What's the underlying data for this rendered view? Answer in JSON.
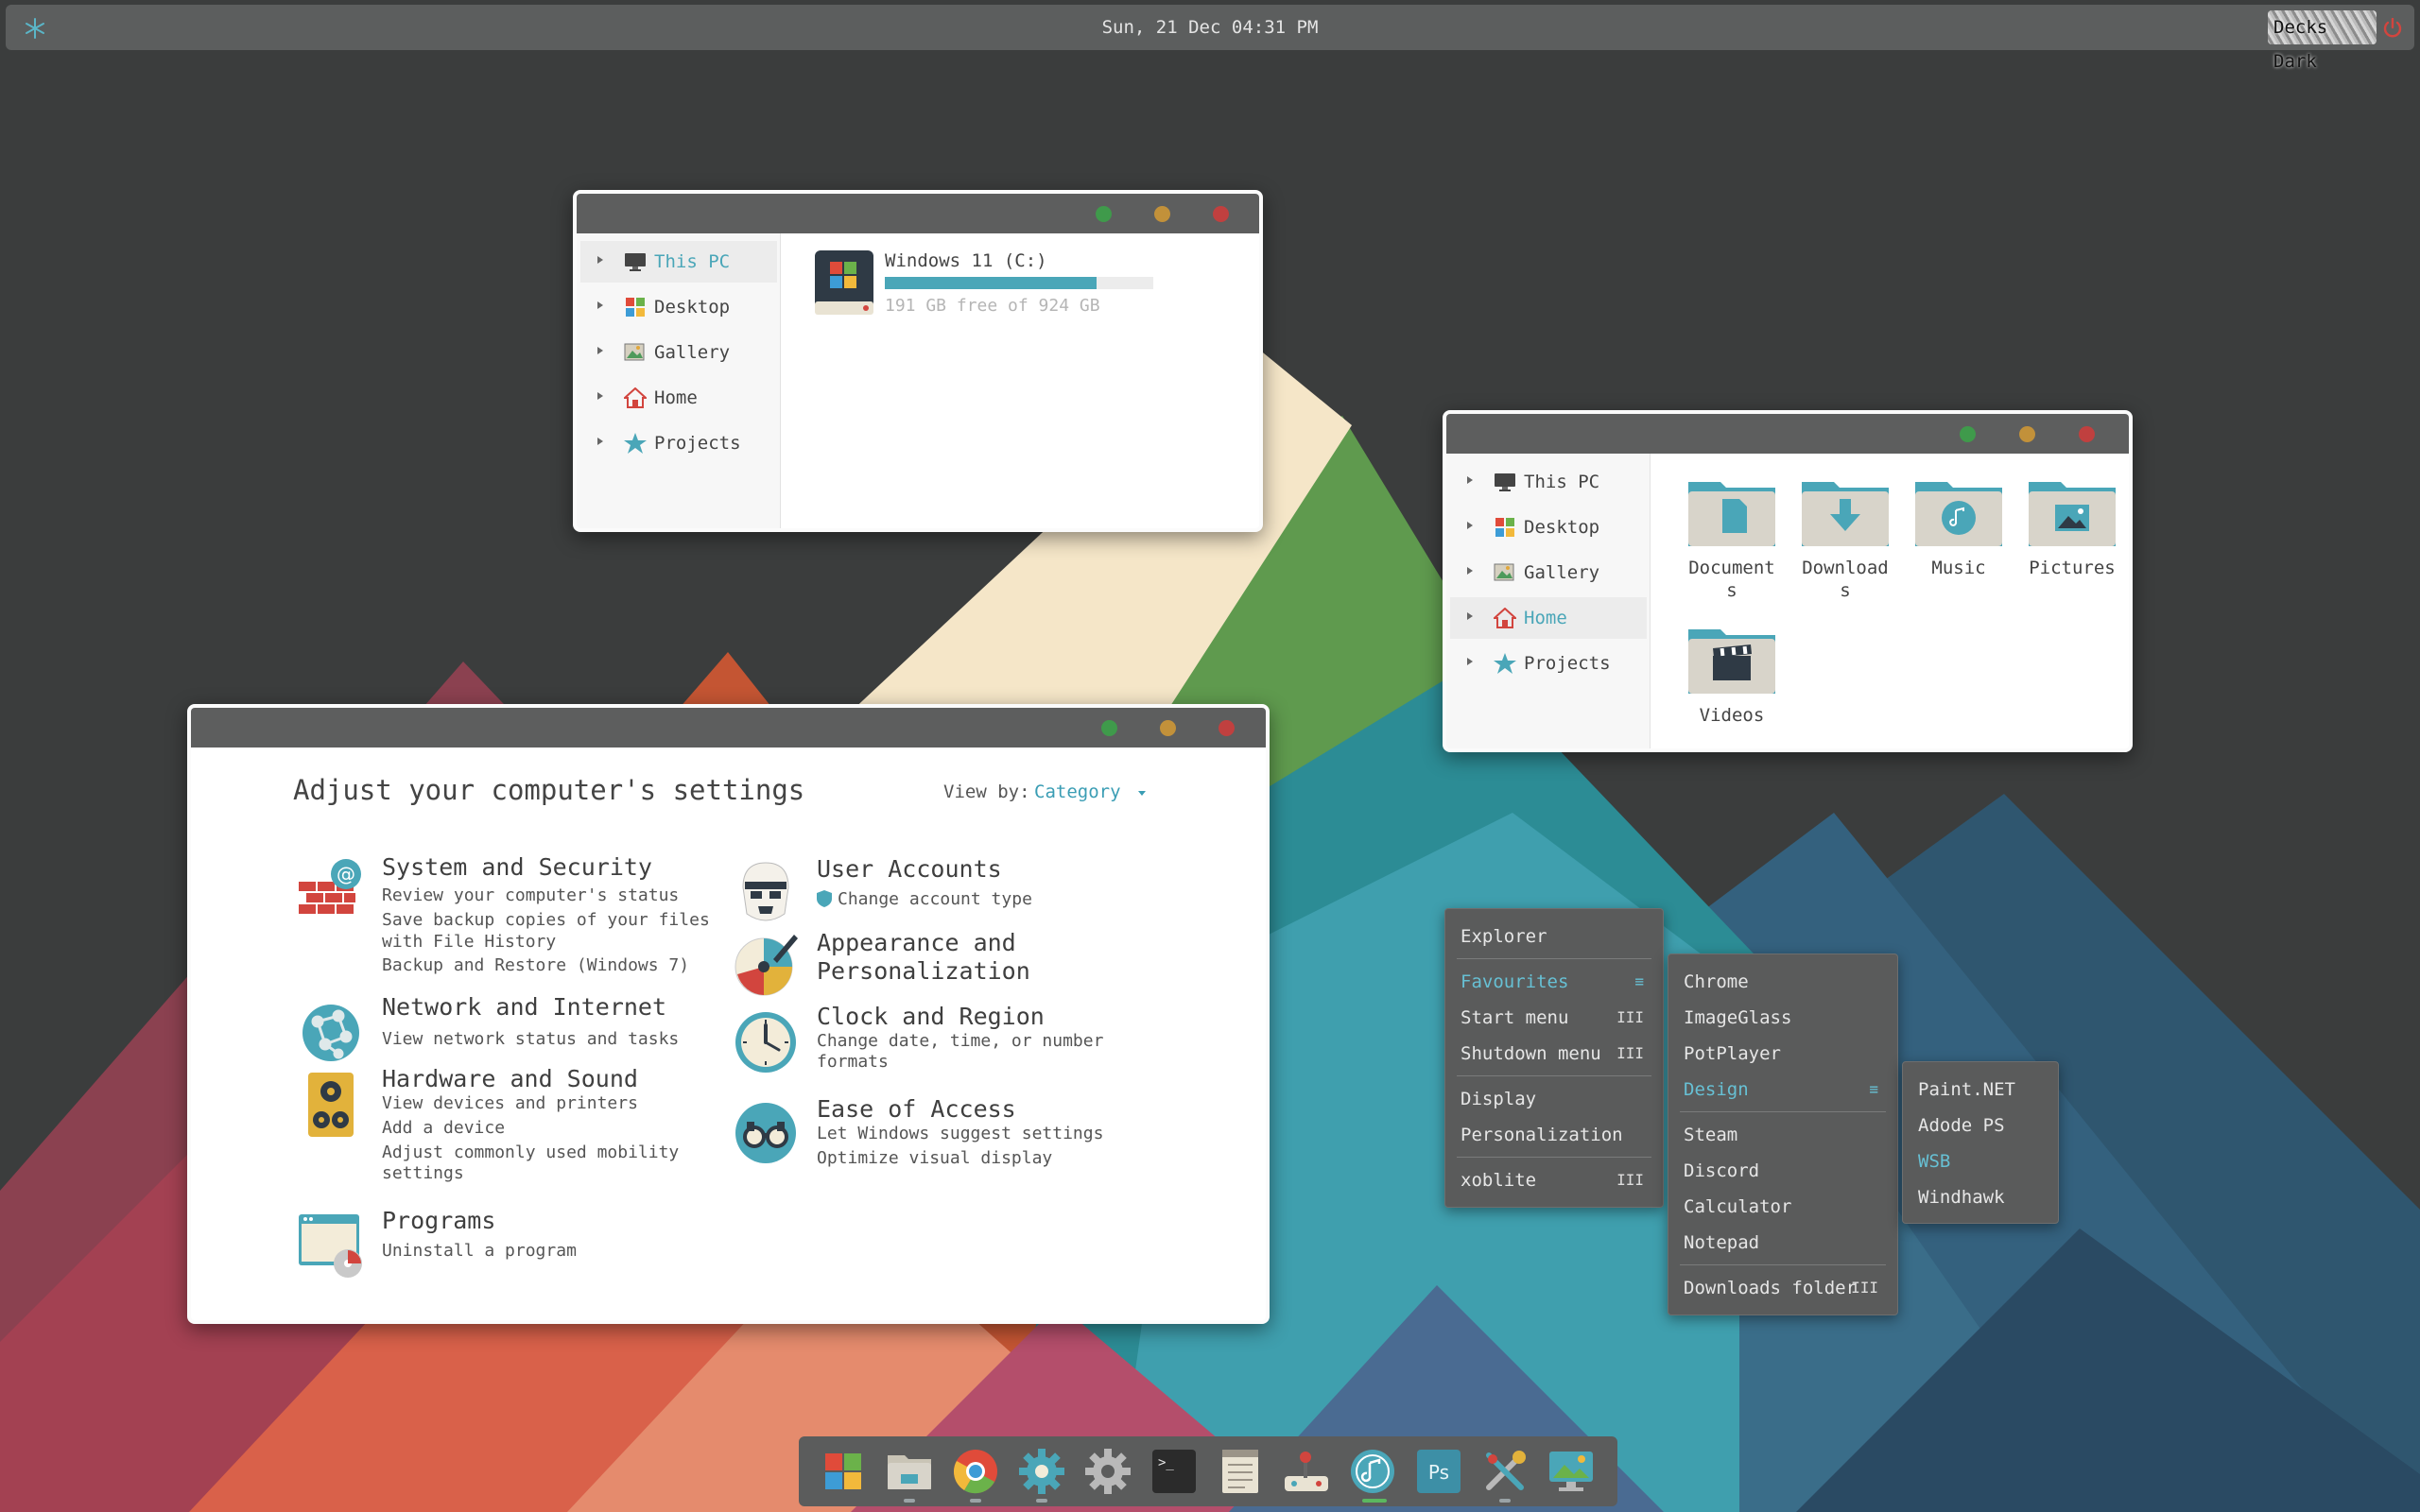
{
  "topbar": {
    "clock": "Sun, 21 Dec 04:31 PM",
    "theme_label": "Decks Dark",
    "left_icon": "snowflake-icon",
    "right_icon": "power-icon"
  },
  "explorer_pc": {
    "sidebar": [
      {
        "label": "This PC",
        "icon": "monitor-icon",
        "active": true
      },
      {
        "label": "Desktop",
        "icon": "windows-logo-icon",
        "active": false
      },
      {
        "label": "Gallery",
        "icon": "gallery-icon",
        "active": false
      },
      {
        "label": "Home",
        "icon": "home-icon",
        "active": false
      },
      {
        "label": "Projects",
        "icon": "star-icon",
        "active": false
      }
    ],
    "drive": {
      "name": "Windows 11 (C:)",
      "free_text": "191 GB free of 924 GB",
      "used_fraction": 0.79
    }
  },
  "explorer_home": {
    "sidebar": [
      {
        "label": "This PC",
        "icon": "monitor-icon",
        "active": false
      },
      {
        "label": "Desktop",
        "icon": "windows-logo-icon",
        "active": false
      },
      {
        "label": "Gallery",
        "icon": "gallery-icon",
        "active": false
      },
      {
        "label": "Home",
        "icon": "home-icon",
        "active": true
      },
      {
        "label": "Projects",
        "icon": "star-icon",
        "active": false
      }
    ],
    "folders": [
      {
        "line1": "Document",
        "line2": "s",
        "icon": "documents-folder-icon"
      },
      {
        "line1": "Download",
        "line2": "s",
        "icon": "downloads-folder-icon"
      },
      {
        "line1": "Music",
        "line2": "",
        "icon": "music-folder-icon"
      },
      {
        "line1": "Pictures",
        "line2": "",
        "icon": "pictures-folder-icon"
      },
      {
        "line1": "Videos",
        "line2": "",
        "icon": "videos-folder-icon"
      }
    ]
  },
  "control_panel": {
    "title": "Adjust your computer's settings",
    "view_by_label": "View by:",
    "view_by_value": "Category",
    "categories": [
      {
        "title": "System and Security",
        "icon": "firewall-icon",
        "links": [
          "Review your computer's status",
          "Save backup copies of your files",
          "with File History",
          "Backup and Restore (Windows 7)"
        ]
      },
      {
        "title": "Network and Internet",
        "icon": "network-globe-icon",
        "links": [
          "View network status and tasks"
        ]
      },
      {
        "title": "Hardware and Sound",
        "icon": "speaker-icon",
        "links": [
          "View devices and printers",
          "Add a device",
          "Adjust commonly used mobility",
          "settings"
        ]
      },
      {
        "title": "Programs",
        "icon": "programs-icon",
        "links": [
          "Uninstall a program"
        ]
      },
      {
        "title": "User Accounts",
        "icon": "user-accounts-icon",
        "links": [
          "Change account type"
        ]
      },
      {
        "title": "Appearance and",
        "title2": "Personalization",
        "icon": "palette-icon",
        "links": []
      },
      {
        "title": "Clock and Region",
        "icon": "clock-icon",
        "links": [
          "Change date, time, or number",
          "formats"
        ]
      },
      {
        "title": "Ease of Access",
        "icon": "ease-of-access-icon",
        "links": [
          "Let Windows suggest settings",
          "Optimize visual display"
        ]
      }
    ]
  },
  "menu_main": {
    "items": [
      {
        "label": "Explorer",
        "glyph": ""
      },
      {
        "label": "Favourites",
        "glyph": "≡",
        "highlight": true
      },
      {
        "label": "Start menu",
        "glyph": "III"
      },
      {
        "label": "Shutdown menu",
        "glyph": "III"
      },
      {
        "label": "Display",
        "glyph": ""
      },
      {
        "label": "Personalization",
        "glyph": ""
      },
      {
        "label": "xoblite",
        "glyph": "III"
      }
    ]
  },
  "menu_favourites": {
    "items": [
      {
        "label": "Chrome",
        "glyph": ""
      },
      {
        "label": "ImageGlass",
        "glyph": ""
      },
      {
        "label": "PotPlayer",
        "glyph": ""
      },
      {
        "label": "Design",
        "glyph": "≡",
        "highlight": true
      },
      {
        "label": "Steam",
        "glyph": ""
      },
      {
        "label": "Discord",
        "glyph": ""
      },
      {
        "label": "Calculator",
        "glyph": ""
      },
      {
        "label": "Notepad",
        "glyph": ""
      },
      {
        "label": "Downloads folder",
        "glyph": "III"
      }
    ]
  },
  "menu_design": {
    "items": [
      {
        "label": "Paint.NET"
      },
      {
        "label": "Adode PS"
      },
      {
        "label": "WSB",
        "highlight": true
      },
      {
        "label": "Windhawk"
      }
    ]
  },
  "dock": {
    "items": [
      {
        "name": "start-icon"
      },
      {
        "name": "file-manager-icon"
      },
      {
        "name": "chrome-icon"
      },
      {
        "name": "settings-icon"
      },
      {
        "name": "control-panel-gear-icon"
      },
      {
        "name": "terminal-icon"
      },
      {
        "name": "notepad-icon"
      },
      {
        "name": "game-controller-icon"
      },
      {
        "name": "music-player-icon"
      },
      {
        "name": "photoshop-icon",
        "label": "Ps"
      },
      {
        "name": "tools-icon"
      },
      {
        "name": "image-viewer-icon"
      }
    ]
  },
  "colors": {
    "accent": "#4aa6b8",
    "titlebar": "#5d5e5e",
    "panel": "#5b5c5c",
    "close": "#c0403f",
    "minimize": "#c2913a",
    "maximize": "#3f9a4b"
  }
}
